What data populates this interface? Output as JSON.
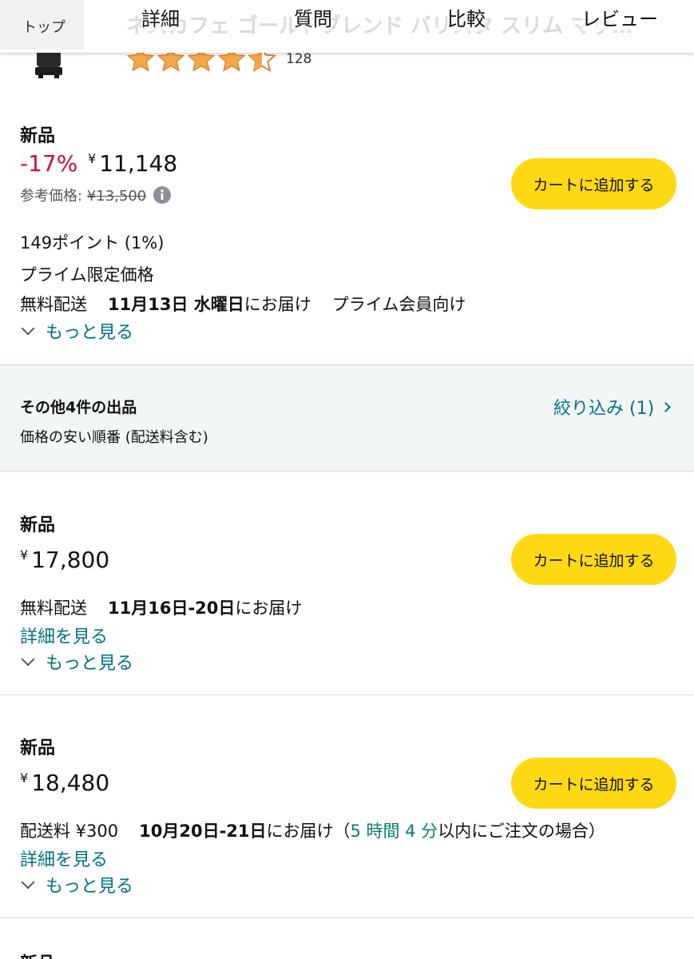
{
  "header": {
    "title": "ネスカフェ ゴールドブレンド バリスタ スリム マットブラ…",
    "top_label": "トップ",
    "tabs": [
      "詳細",
      "質問",
      "比較",
      "レビュー"
    ]
  },
  "rating": {
    "stars": 4.5,
    "count": "128"
  },
  "featured_offer": {
    "condition": "新品",
    "discount": "-17%",
    "currency": "¥",
    "price": "11,148",
    "ref_price_label": "参考価格:",
    "ref_price": "¥13,500",
    "points": "149ポイント (1%)",
    "prime_price": "プライム限定価格",
    "delivery_prefix": "無料配送",
    "delivery_date": "11月13日 水曜日",
    "delivery_suffix": "にお届け",
    "prime_note": "プライム会員向け",
    "more": "もっと見る",
    "cart_button": "カートに追加する"
  },
  "other_sellers": {
    "title": "その他4件の出品",
    "subtitle": "価格の安い順番 (配送料含む)",
    "filter": "絞り込み (1)"
  },
  "offers": [
    {
      "condition": "新品",
      "currency": "¥",
      "price": "17,800",
      "shipping": "無料配送",
      "delivery_date": "11月16日-20日",
      "delivery_suffix": "にお届け",
      "details": "詳細を見る",
      "more": "もっと見る",
      "cart_button": "カートに追加する"
    },
    {
      "condition": "新品",
      "currency": "¥",
      "price": "18,480",
      "shipping": "配送料 ¥300",
      "delivery_date": "10月20日-21日",
      "delivery_suffix": "にお届け（",
      "countdown": "5 時間 4 分",
      "countdown_suffix": "以内にご注文の場合）",
      "details": "詳細を見る",
      "more": "もっと見る",
      "cart_button": "カートに追加する"
    }
  ],
  "next_offer_partial": {
    "condition": "新品"
  },
  "colors": {
    "star": "#f3a847",
    "discount": "#cc0c39",
    "cart": "#ffd814",
    "link": "#007185",
    "green": "#067d62"
  }
}
